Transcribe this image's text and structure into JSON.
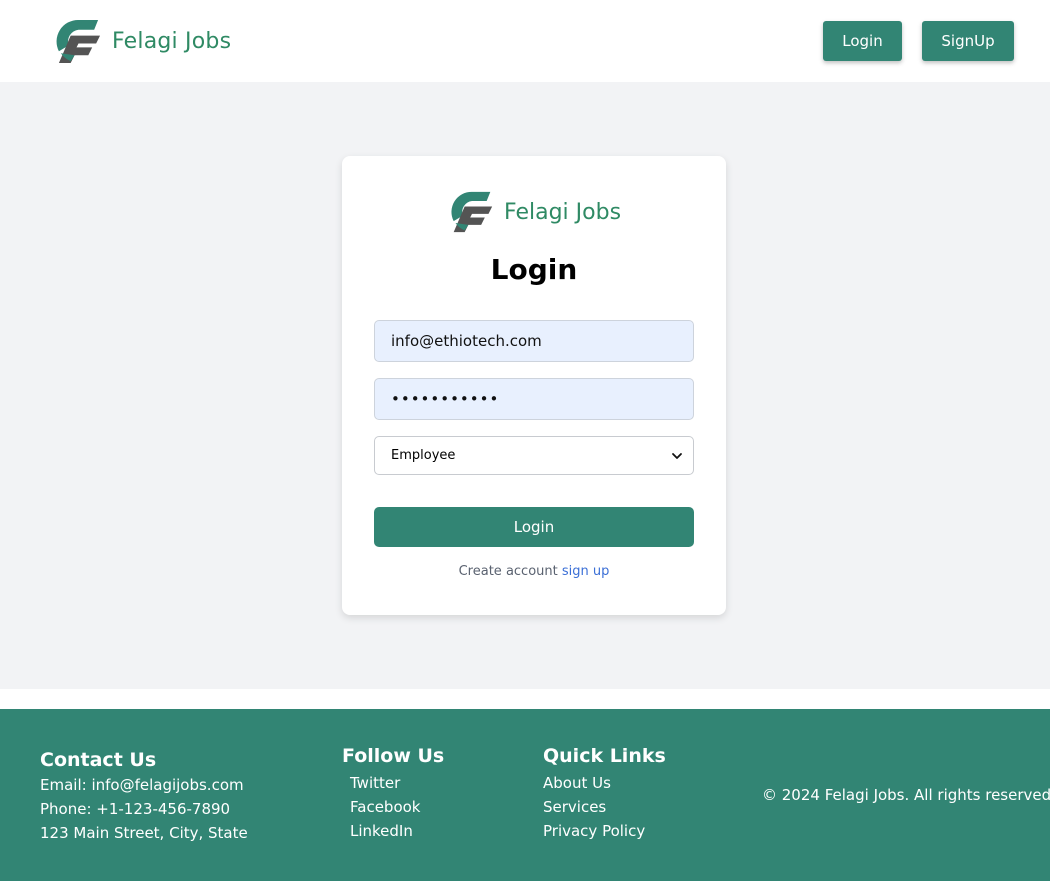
{
  "header": {
    "brand_name": "Felagi Jobs",
    "login_label": "Login",
    "signup_label": "SignUp"
  },
  "login_card": {
    "brand_name": "Felagi Jobs",
    "title": "Login",
    "email_value": "info@ethiotech.com",
    "password_masked": "•••••••••••",
    "role_selected": "Employee",
    "submit_label": "Login",
    "signup_prompt": "Create account",
    "signup_link": "sign up"
  },
  "footer": {
    "contact": {
      "heading": "Contact Us",
      "email": "Email: info@felagijobs.com",
      "phone": "Phone: +1-123-456-7890",
      "address": "123 Main Street, City, State"
    },
    "follow": {
      "heading": "Follow Us",
      "links": [
        "Twitter",
        "Facebook",
        "LinkedIn"
      ]
    },
    "quick_links": {
      "heading": "Quick Links",
      "links": [
        "About Us",
        "Services",
        "Privacy Policy"
      ]
    },
    "copyright": "© 2024 Felagi Jobs. All rights reserved."
  },
  "colors": {
    "primary": "#328574",
    "brand_text": "#2f8a64",
    "logo_dark": "#545454",
    "page_bg": "#f2f3f5",
    "input_fill": "#e8f0fe",
    "link": "#3b6fd6"
  },
  "icons": {
    "logo": "felagi-f-logo-icon",
    "select_arrow": "chevron-down-icon"
  }
}
